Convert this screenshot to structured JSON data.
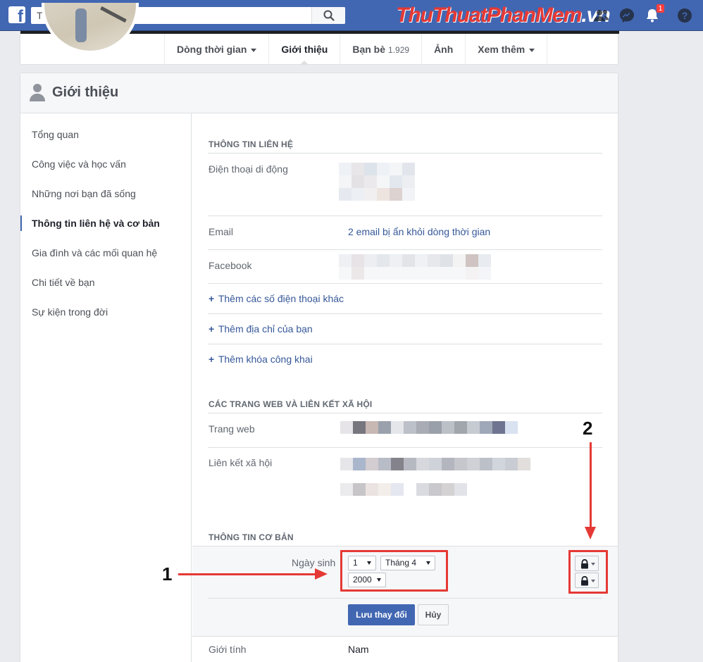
{
  "topbar": {
    "logo_glyph": "f",
    "search_placeholder": "Tìm kiếm",
    "watermark_part1": "Thu",
    "watermark_part2": "Thuat",
    "watermark_part3": "PhanMem",
    "watermark_part4": ".vn",
    "notifications_count": "1",
    "color": "#4267b2"
  },
  "profile_nav": {
    "tabs": [
      {
        "label": "Dòng thời gian",
        "has_dropdown": true
      },
      {
        "label": "Giới thiệu",
        "active": true
      },
      {
        "label": "Bạn bè",
        "count": "1.929"
      },
      {
        "label": "Ảnh"
      },
      {
        "label": "Xem thêm",
        "has_dropdown": true
      }
    ]
  },
  "about": {
    "title": "Giới thiệu",
    "nav_items": [
      "Tổng quan",
      "Công việc và học vấn",
      "Những nơi bạn đã sống",
      "Thông tin liên hệ và cơ bản",
      "Gia đình và các mối quan hệ",
      "Chi tiết về bạn",
      "Sự kiện trong đời"
    ],
    "active_nav_index": 3
  },
  "contact": {
    "section_title": "THÔNG TIN LIÊN HỆ",
    "mobile_label": "Điện thoại di động",
    "email_label": "Email",
    "email_value": "2 email bị ẩn khỏi dòng thời gian",
    "facebook_label": "Facebook",
    "add_phone": "Thêm các số điện thoại khác",
    "add_address": "Thêm địa chỉ của bạn",
    "add_key": "Thêm khóa công khai"
  },
  "web": {
    "section_title": "CÁC TRANG WEB VÀ LIÊN KẾT XÃ HỘI",
    "website_label": "Trang web",
    "social_label": "Liên kết xã hội"
  },
  "basic": {
    "section_title": "THÔNG TIN CƠ BẢN",
    "dob_label": "Ngày sinh",
    "day_value": "1",
    "month_value": "Tháng 4",
    "year_value": "2000",
    "save_label": "Lưu thay đổi",
    "cancel_label": "Hủy",
    "gender_label": "Giới tính",
    "gender_value": "Nam"
  },
  "annotations": {
    "label1": "1",
    "label2": "2",
    "color": "#e53935"
  }
}
